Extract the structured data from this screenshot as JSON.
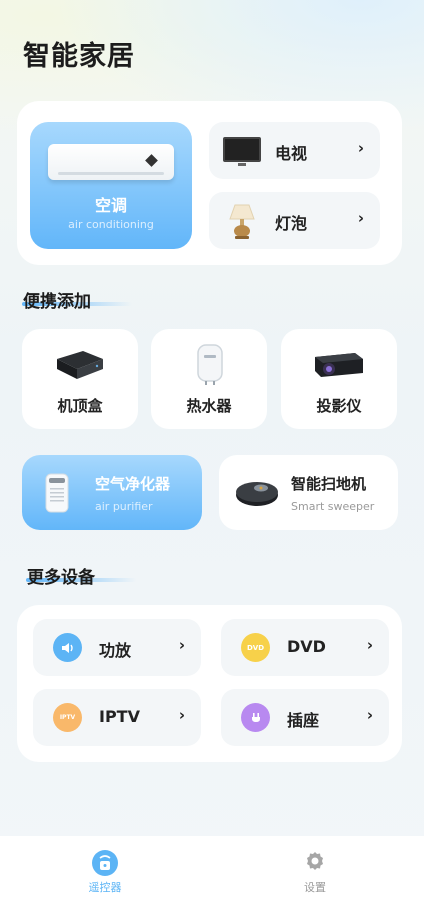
{
  "page_title": "智能家居",
  "top": {
    "ac": {
      "name": "空调",
      "sub": "air conditioning"
    },
    "items": [
      {
        "label": "电视",
        "chevron": "›"
      },
      {
        "label": "灯泡",
        "chevron": "›"
      }
    ]
  },
  "quick_add": {
    "title": "便携添加",
    "tiles": [
      {
        "label": "机顶盒"
      },
      {
        "label": "热水器"
      },
      {
        "label": "投影仪"
      }
    ],
    "wide": [
      {
        "label": "空气净化器",
        "sub": "air purifier"
      },
      {
        "label": "智能扫地机",
        "sub": "Smart sweeper"
      }
    ]
  },
  "more": {
    "title": "更多设备",
    "devices": [
      {
        "label": "功放",
        "chevron": "›",
        "color": "#5cb4f5"
      },
      {
        "label": "DVD",
        "chevron": "›",
        "color": "#f7d14a",
        "glyph": "DVD"
      },
      {
        "label": "IPTV",
        "chevron": "›",
        "color": "#f9b86a",
        "glyph": "IPTV"
      },
      {
        "label": "插座",
        "chevron": "›",
        "color": "#b889f0"
      }
    ]
  },
  "tabs": [
    {
      "label": "遥控器",
      "active": true
    },
    {
      "label": "设置",
      "active": false
    }
  ],
  "colors": {
    "accent": "#5cb4f5",
    "accent_light": "#a7d8fd",
    "text_muted": "#999999"
  }
}
